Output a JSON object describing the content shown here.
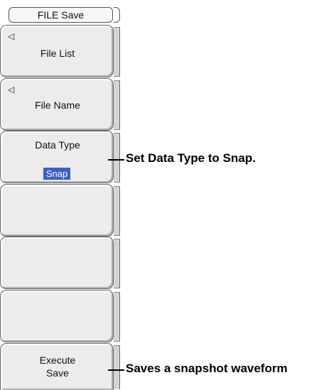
{
  "menu": {
    "title": "FILE Save",
    "buttons": [
      {
        "label": "File List",
        "has_arrow": true
      },
      {
        "label": "File Name",
        "has_arrow": true
      },
      {
        "label": "Data Type",
        "value": "Snap"
      },
      {
        "label": ""
      },
      {
        "label": ""
      },
      {
        "label": ""
      },
      {
        "label_line1": "Execute",
        "label_line2": "Save"
      }
    ],
    "arrow_glyph": "◁",
    "accent_color": "#3b5fc8"
  },
  "callouts": {
    "data_type": "Set Data Type to Snap.",
    "execute": "Saves a snapshot waveform"
  }
}
